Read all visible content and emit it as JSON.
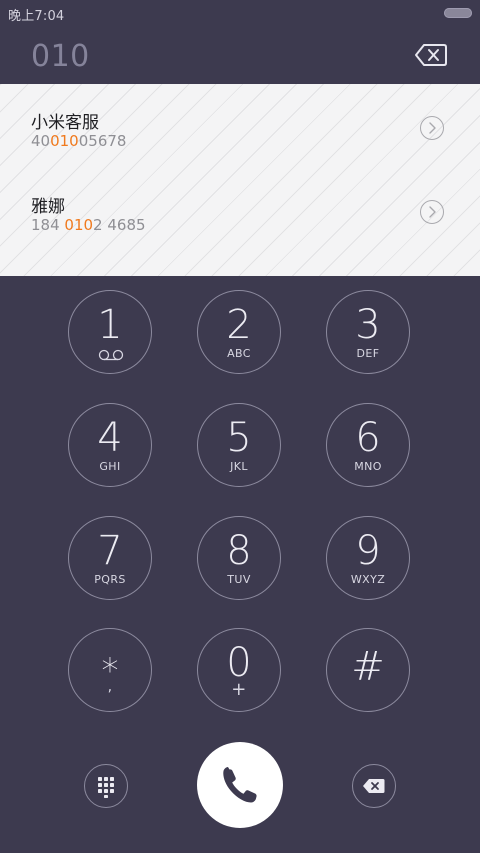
{
  "status_bar": {
    "time": "晚上7:04"
  },
  "dialer": {
    "dialed_number": "010"
  },
  "suggestions": [
    {
      "name": "小米客服",
      "number_parts": [
        "40",
        "010",
        "05678"
      ]
    },
    {
      "name": "雅娜",
      "number_parts": [
        "184 ",
        "010",
        "2 4685"
      ]
    }
  ],
  "keypad": {
    "keys": [
      {
        "digit": "1",
        "letters": ""
      },
      {
        "digit": "2",
        "letters": "ABC"
      },
      {
        "digit": "3",
        "letters": "DEF"
      },
      {
        "digit": "4",
        "letters": "GHI"
      },
      {
        "digit": "5",
        "letters": "JKL"
      },
      {
        "digit": "6",
        "letters": "MNO"
      },
      {
        "digit": "7",
        "letters": "PQRS"
      },
      {
        "digit": "8",
        "letters": "TUV"
      },
      {
        "digit": "9",
        "letters": "WXYZ"
      },
      {
        "digit": "*",
        "letters": ","
      },
      {
        "digit": "0",
        "letters": "+"
      },
      {
        "digit": "#",
        "letters": ""
      }
    ]
  },
  "icons": {
    "voicemail": "voicemail-icon",
    "backspace": "backspace-icon",
    "dialpad": "dialpad-grid-icon",
    "call": "phone-icon",
    "detail": "chevron-right-icon"
  },
  "colors": {
    "background": "#3d3a4f",
    "highlight": "#f07a1e",
    "suggestion_bg": "#f4f4f5"
  }
}
